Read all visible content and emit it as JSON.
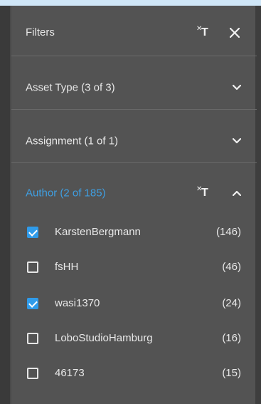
{
  "panel": {
    "title": "Filters",
    "clear_icon": "clear-filter-icon",
    "close_icon": "close-icon"
  },
  "sections": [
    {
      "label": "Asset Type (3 of 3)",
      "expanded": false,
      "icon": "chevron-down-icon"
    },
    {
      "label": "Assignment (1 of 1)",
      "expanded": false,
      "icon": "chevron-down-icon"
    },
    {
      "label": "Author (2 of 185)",
      "expanded": true,
      "icon": "chevron-up-icon"
    }
  ],
  "author_items": [
    {
      "label": "KarstenBergmann",
      "count": "(146)",
      "checked": true
    },
    {
      "label": "fsHH",
      "count": "(46)",
      "checked": false
    },
    {
      "label": "wasi1370",
      "count": "(24)",
      "checked": true
    },
    {
      "label": "LoboStudioHamburg",
      "count": "(16)",
      "checked": false
    },
    {
      "label": "46173",
      "count": "(15)",
      "checked": false
    }
  ],
  "colors": {
    "panel_bg": "#535353",
    "accent": "#3f9ee0",
    "checkbox_checked": "#2f9bea",
    "text": "#e8e8e8"
  }
}
